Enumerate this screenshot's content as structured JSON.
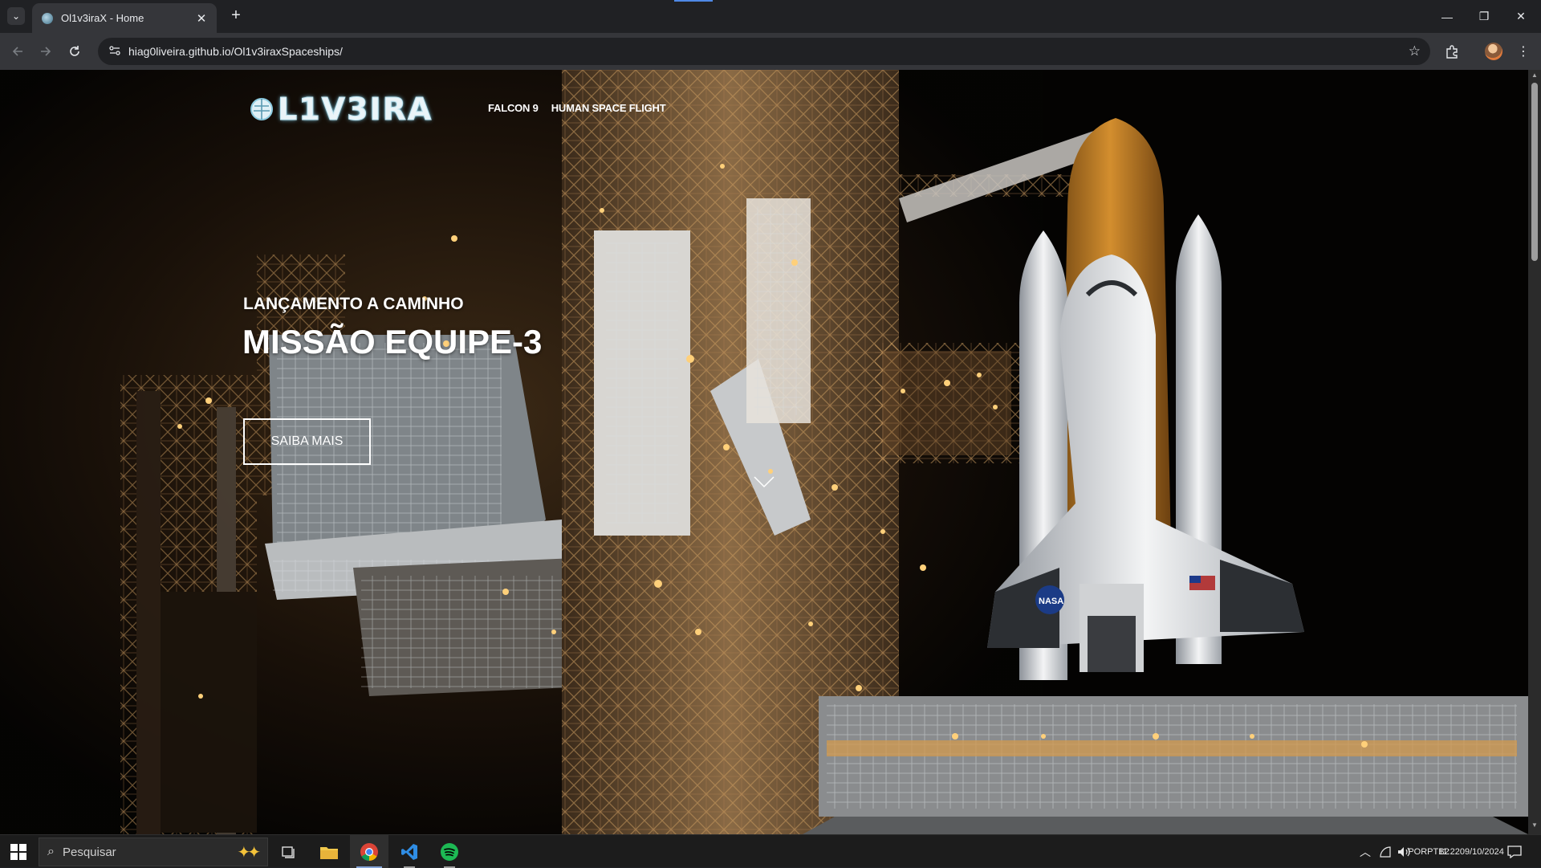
{
  "browser": {
    "tab_title": "Ol1v3iraX - Home",
    "tab_close": "✕",
    "new_tab": "+",
    "tab_menu": "⌄",
    "url": "hiag0liveira.github.io/Ol1v3iraxSpaceships/",
    "window_controls": {
      "minimize": "—",
      "restore": "❐",
      "close": "✕"
    }
  },
  "site": {
    "logo_text": "L1V3IRA",
    "nav": [
      {
        "label": "FALCON 9"
      },
      {
        "label": "HUMAN SPACE FLIGHT"
      }
    ],
    "hero": {
      "subtitle": "LANÇAMENTO A CAMINHO",
      "title": "MISSÃO EQUIPE-3",
      "button_label": "SAIBA MAIS"
    }
  },
  "taskbar": {
    "search_placeholder": "Pesquisar",
    "language_line1": "POR",
    "language_line2": "PTB2",
    "time": "11:22",
    "date": "09/10/2024"
  },
  "icons": [
    "windows-start-icon",
    "search-icon",
    "task-view-icon",
    "file-explorer-icon",
    "chrome-icon",
    "vscode-icon",
    "spotify-icon",
    "chevron-up-icon",
    "network-icon",
    "volume-icon",
    "notification-icon",
    "back-icon",
    "forward-icon",
    "reload-icon",
    "site-info-icon",
    "star-icon",
    "extensions-icon",
    "menu-icon"
  ],
  "colors": {
    "chrome_dark": "#202124",
    "chrome_toolbar": "#35363a",
    "taskbar": "#1c1c1c",
    "spotify": "#1db954",
    "vscode": "#2f8de4"
  }
}
